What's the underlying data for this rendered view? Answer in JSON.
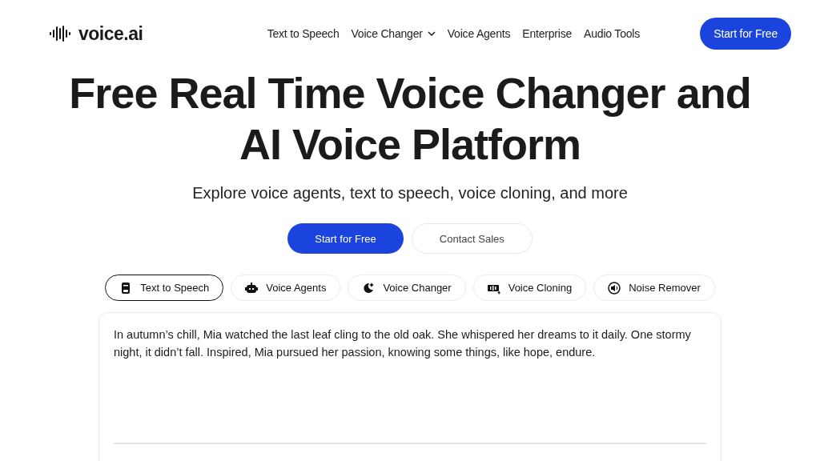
{
  "header": {
    "logo": "voice.ai",
    "nav": [
      {
        "label": "Text to Speech",
        "kind": "link"
      },
      {
        "label": "Voice Changer",
        "kind": "dropdown"
      },
      {
        "label": "Voice Agents",
        "kind": "link"
      },
      {
        "label": "Enterprise",
        "kind": "link"
      },
      {
        "label": "Audio Tools",
        "kind": "link"
      }
    ],
    "cta": "Start for Free"
  },
  "hero": {
    "title": "Free Real Time Voice Changer and AI Voice Platform",
    "subtitle": "Explore voice agents, text to speech, voice cloning, and more",
    "buttons": [
      {
        "label": "Start for Free",
        "kind": "primary"
      },
      {
        "label": "Contact Sales",
        "kind": "secondary"
      }
    ]
  },
  "tabs": [
    {
      "label": "Text to Speech",
      "selected": true
    },
    {
      "label": "Voice Agents",
      "selected": false
    },
    {
      "label": "Voice Changer",
      "selected": false
    },
    {
      "label": "Voice Cloning",
      "selected": false
    },
    {
      "label": "Noise Remover",
      "selected": false
    }
  ],
  "editor": {
    "value": "In autumn’s chill, Mia watched the last leaf cling to the old oak. She whispered her dreams to it daily. One stormy night, it didn’t fall. Inspired, Mia pursued her passion, knowing some things, like hope, endure."
  }
}
